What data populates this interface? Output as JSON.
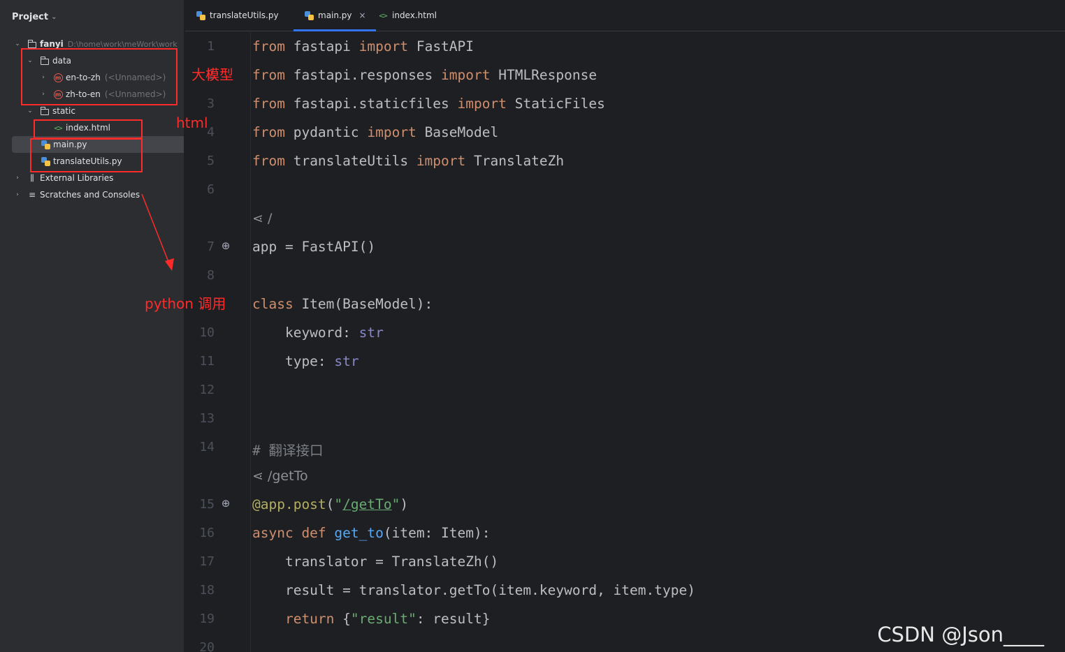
{
  "sidebar": {
    "title": "Project",
    "tree": [
      {
        "label": "fanyi",
        "path": "D:\\home\\work\\meWork\\work",
        "icon": "folder-icon",
        "expanded": true
      },
      {
        "label": "data",
        "icon": "folder-icon",
        "expanded": true
      },
      {
        "label": "en-to-zh",
        "suffix": "(<Unnamed>)",
        "icon": "model-icon",
        "expanded": false
      },
      {
        "label": "zh-to-en",
        "suffix": "(<Unnamed>)",
        "icon": "model-icon",
        "expanded": false
      },
      {
        "label": "static",
        "icon": "folder-icon",
        "expanded": true
      },
      {
        "label": "index.html",
        "icon": "html-file-icon"
      },
      {
        "label": "main.py",
        "icon": "python-file-icon",
        "selected": true
      },
      {
        "label": "translateUtils.py",
        "icon": "python-file-icon"
      },
      {
        "label": "External Libraries",
        "icon": "library-icon",
        "expanded": false
      },
      {
        "label": "Scratches and Consoles",
        "icon": "scratches-icon",
        "expanded": false
      }
    ]
  },
  "annotations": {
    "model_label": "大模型",
    "html_label": "html",
    "python_label": "python  调用",
    "color": "#ff2a2a"
  },
  "tabs": [
    {
      "label": "translateUtils.py",
      "icon": "python-file-icon",
      "active": false
    },
    {
      "label": "main.py",
      "icon": "python-file-icon",
      "active": true,
      "close": "×"
    },
    {
      "label": "index.html",
      "icon": "html-file-icon",
      "active": false
    }
  ],
  "editor": {
    "lines": [
      {
        "n": "1",
        "tokens": [
          [
            "kw",
            "from"
          ],
          [
            "p",
            " fastapi "
          ],
          [
            "kw",
            "import"
          ],
          [
            "p",
            " FastAPI"
          ]
        ]
      },
      {
        "n": "2",
        "tokens": [
          [
            "kw",
            "from"
          ],
          [
            "p",
            " fastapi.responses "
          ],
          [
            "kw",
            "import"
          ],
          [
            "p",
            " HTMLResponse"
          ]
        ]
      },
      {
        "n": "3",
        "tokens": [
          [
            "kw",
            "from"
          ],
          [
            "p",
            " fastapi.staticfiles "
          ],
          [
            "kw",
            "import"
          ],
          [
            "p",
            " StaticFiles"
          ]
        ]
      },
      {
        "n": "4",
        "tokens": [
          [
            "kw",
            "from"
          ],
          [
            "p",
            " pydantic "
          ],
          [
            "kw",
            "import"
          ],
          [
            "p",
            " BaseModel"
          ]
        ]
      },
      {
        "n": "5",
        "tokens": [
          [
            "kw",
            "from"
          ],
          [
            "p",
            " translateUtils "
          ],
          [
            "kw",
            "import"
          ],
          [
            "p",
            " TranslateZh"
          ]
        ]
      },
      {
        "n": "6",
        "tokens": []
      },
      {
        "n": "",
        "hint": true,
        "tokens": [
          [
            "hint",
            "/"
          ]
        ]
      },
      {
        "n": "7",
        "gutter_icon": "endpoint-icon",
        "tokens": [
          [
            "p",
            "app = FastAPI()"
          ]
        ]
      },
      {
        "n": "8",
        "tokens": []
      },
      {
        "n": "",
        "tokens": [
          [
            "kw",
            "class"
          ],
          [
            "p",
            " Item(BaseModel):"
          ]
        ]
      },
      {
        "n": "10",
        "tokens": [
          [
            "p",
            "    keyword: "
          ],
          [
            "builtin",
            "str"
          ]
        ]
      },
      {
        "n": "11",
        "tokens": [
          [
            "p",
            "    type: "
          ],
          [
            "builtin",
            "str"
          ]
        ]
      },
      {
        "n": "12",
        "tokens": []
      },
      {
        "n": "13",
        "tokens": []
      },
      {
        "n": "14",
        "tokens": [
          [
            "cmt",
            "# 翻译接口"
          ]
        ]
      },
      {
        "n": "",
        "hint": true,
        "tokens": [
          [
            "hint",
            "/getTo"
          ]
        ]
      },
      {
        "n": "15",
        "gutter_icon": "endpoint-icon",
        "tokens": [
          [
            "deco",
            "@app.post"
          ],
          [
            "p",
            "("
          ],
          [
            "str",
            "\""
          ],
          [
            "strlink",
            "/getTo"
          ],
          [
            "str",
            "\""
          ],
          [
            "p",
            ")"
          ]
        ]
      },
      {
        "n": "16",
        "tokens": [
          [
            "kw",
            "async def "
          ],
          [
            "fn",
            "get_to"
          ],
          [
            "p",
            "(item: Item):"
          ]
        ]
      },
      {
        "n": "17",
        "tokens": [
          [
            "p",
            "    translator = TranslateZh()"
          ]
        ]
      },
      {
        "n": "18",
        "tokens": [
          [
            "p",
            "    result = translator.getTo(item.keyword, item.type)"
          ]
        ]
      },
      {
        "n": "19",
        "tokens": [
          [
            "kw",
            "    return"
          ],
          [
            "p",
            " {"
          ],
          [
            "str",
            "\"result\""
          ],
          [
            "p",
            ": result}"
          ]
        ]
      },
      {
        "n": "20",
        "tokens": []
      }
    ]
  },
  "watermark": "CSDN @Json____"
}
